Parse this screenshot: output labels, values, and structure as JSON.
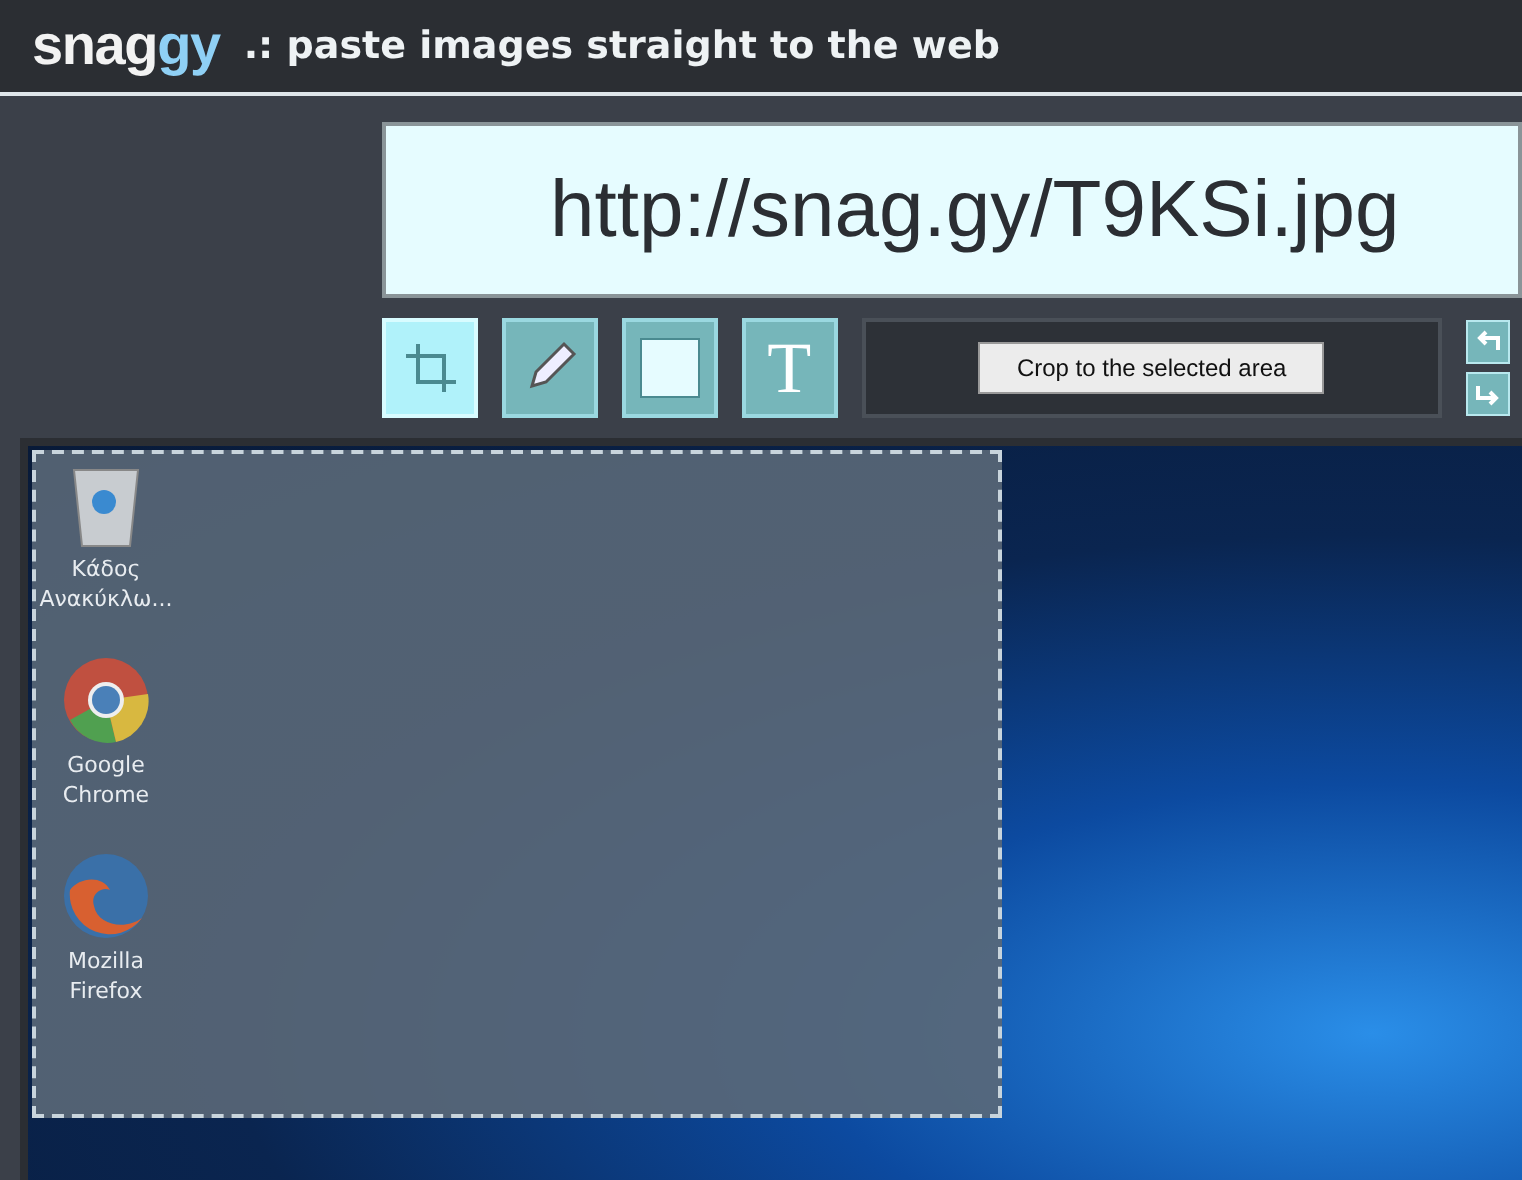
{
  "header": {
    "logo_main": "snag",
    "logo_accent": "gy",
    "tagline": ".: paste images straight to the web"
  },
  "url": "http://snag.gy/T9KSi.jpg",
  "tools": [
    {
      "kind": "crop",
      "selected": true
    },
    {
      "kind": "pencil",
      "selected": false
    },
    {
      "kind": "rectangle",
      "selected": false
    },
    {
      "kind": "text",
      "label": "T",
      "selected": false
    }
  ],
  "action_button": "Crop to the selected area",
  "desktop_icons": [
    {
      "kind": "recycle-bin",
      "label": "Κάδος Ανακύκλω..."
    },
    {
      "kind": "chrome",
      "label": "Google Chrome"
    },
    {
      "kind": "firefox",
      "label": "Mozilla Firefox"
    }
  ]
}
